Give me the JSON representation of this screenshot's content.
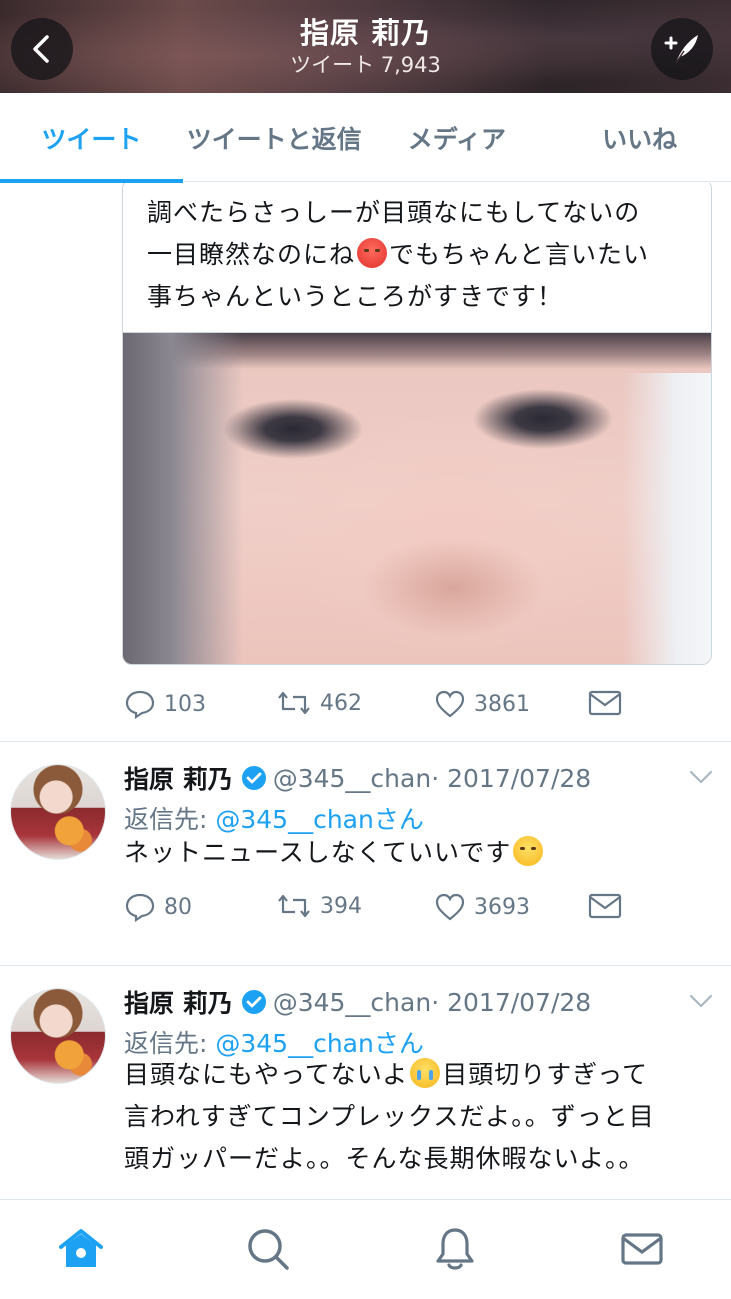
{
  "header": {
    "title": "指原 莉乃",
    "subtitle": "ツイート 7,943"
  },
  "tabs": [
    {
      "label": "ツイート",
      "active": true
    },
    {
      "label": "ツイートと返信",
      "active": false
    },
    {
      "label": "メディア",
      "active": false
    },
    {
      "label": "いいね",
      "active": false
    }
  ],
  "quoted_tweet": {
    "line1": "調べたらさっしーが目頭なにもしてないの",
    "line2_a": "一目瞭然なのにね",
    "line2_b": "でもちゃんと言いたい",
    "line3": "事ちゃんというところがすきです！",
    "emoji": "angry-face-emoji"
  },
  "first_actions": {
    "replies": "103",
    "retweets": "462",
    "likes": "3861"
  },
  "tweets": [
    {
      "name": "指原 莉乃",
      "handle": "@345__chan",
      "date": "· 2017/07/28",
      "reply_label": "返信先: ",
      "reply_mention": "@345__chanさん",
      "body_a": "ネットニュースしなくていいです",
      "replies": "80",
      "retweets": "394",
      "likes": "3693"
    },
    {
      "name": "指原 莉乃",
      "handle": "@345__chan",
      "date": "· 2017/07/28",
      "reply_label": "返信先: ",
      "reply_mention": "@345__chanさん",
      "body_a": "目頭なにもやってないよ",
      "body_b": "目頭切りすぎって",
      "body_c": "言われすぎてコンプレックスだよ。。ずっと目",
      "body_d": "頭ガッパーだよ。。そんな長期休暇ないよ。。"
    }
  ],
  "colors": {
    "accent": "#1da1f2",
    "secondary_text": "#657786",
    "border": "#e1e8ed"
  },
  "nav": [
    "home-icon",
    "search-icon",
    "notifications-icon",
    "messages-icon"
  ]
}
